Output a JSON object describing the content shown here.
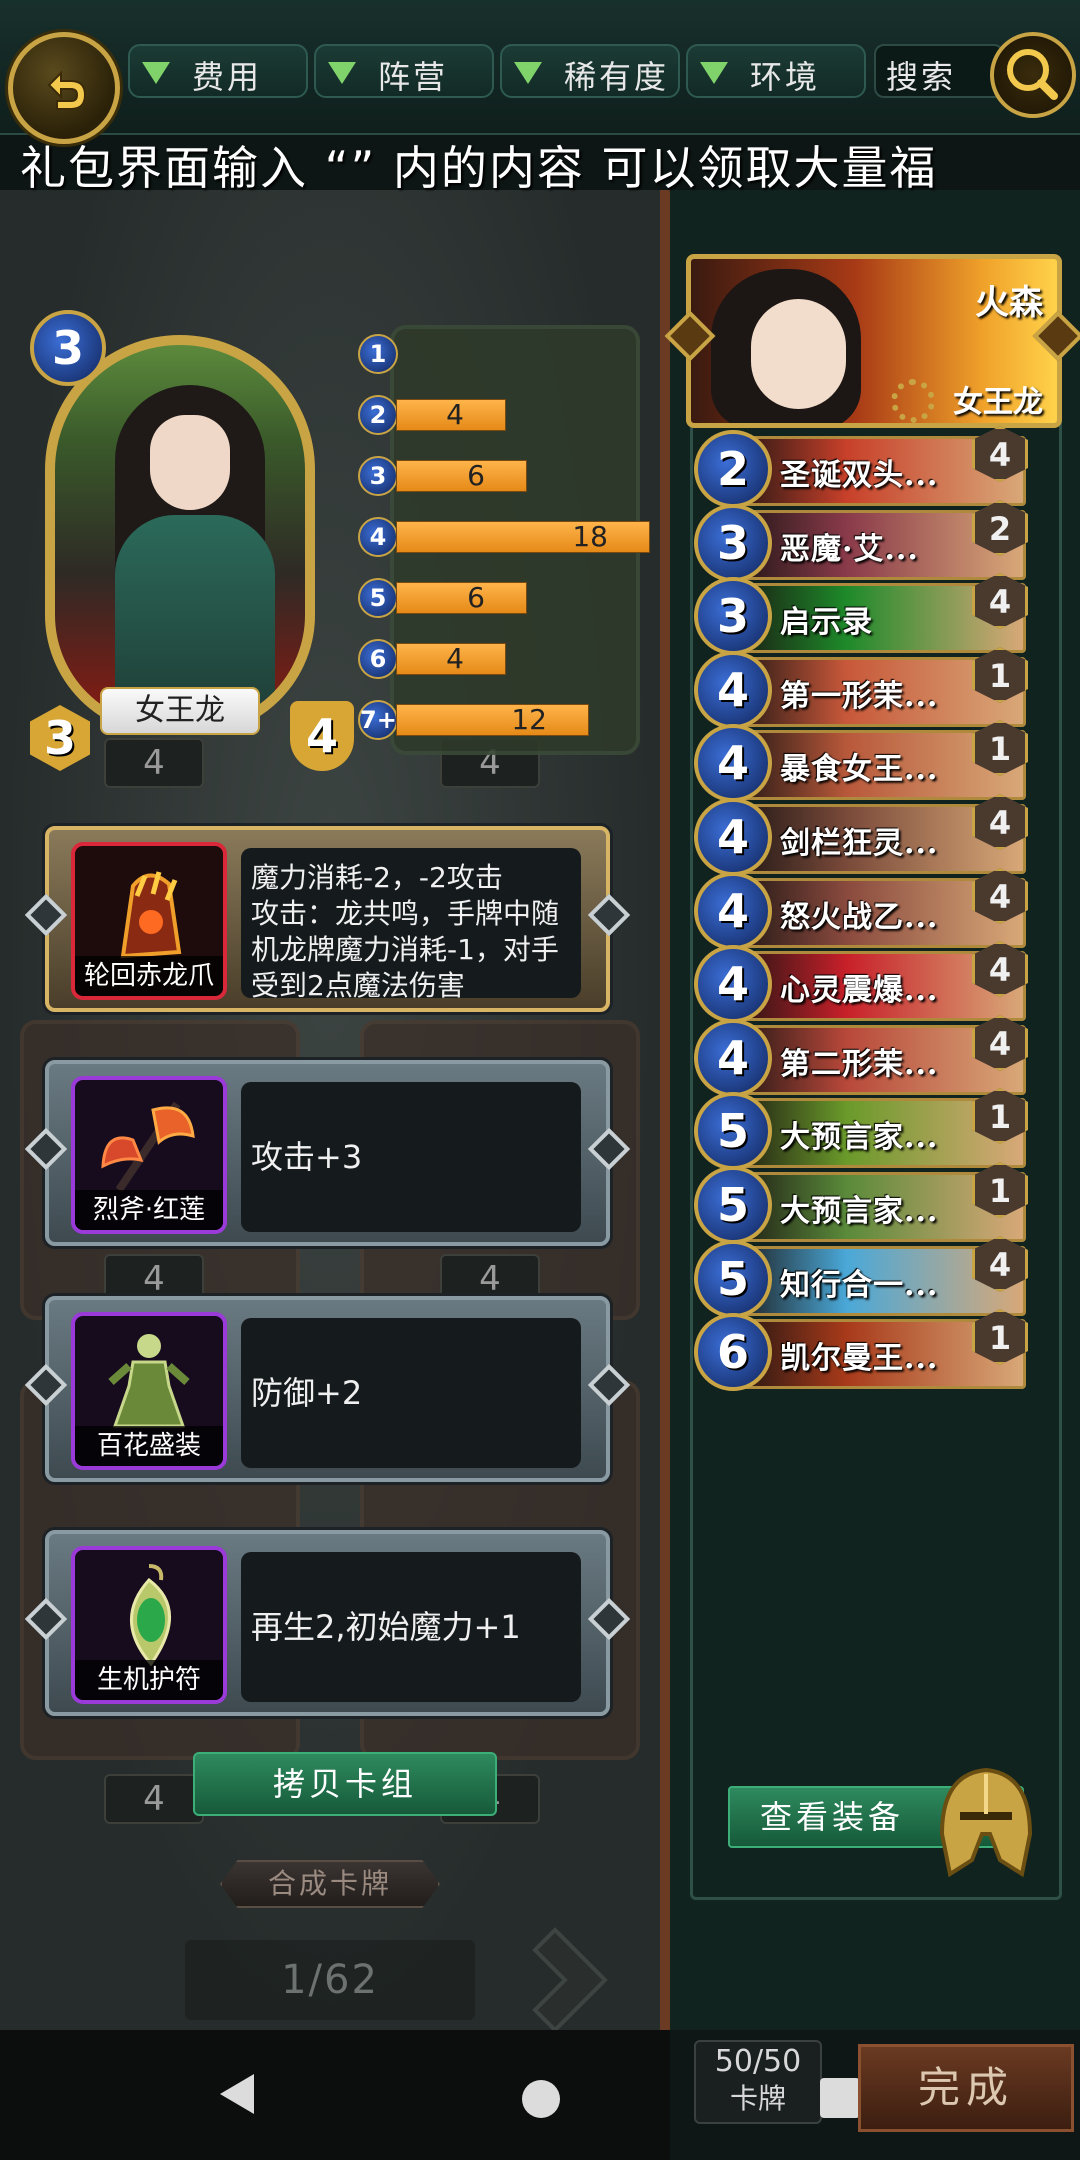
{
  "filters": [
    {
      "label": "费用"
    },
    {
      "label": "阵营"
    },
    {
      "label": "稀有度"
    },
    {
      "label": "环境"
    }
  ],
  "search": {
    "label": "搜索"
  },
  "marquee": "礼包界面输入 “” 内的内容 可以领取大量福",
  "hero_card": {
    "name": "女王龙",
    "cost": "3",
    "attack": "3",
    "defense": "4"
  },
  "mana_curve": [
    {
      "cost": "1",
      "count": "",
      "fraction": 0
    },
    {
      "cost": "2",
      "count": "4",
      "fraction": 0.22
    },
    {
      "cost": "3",
      "count": "6",
      "fraction": 0.33
    },
    {
      "cost": "4",
      "count": "18",
      "fraction": 1.0
    },
    {
      "cost": "5",
      "count": "6",
      "fraction": 0.33
    },
    {
      "cost": "6",
      "count": "4",
      "fraction": 0.22
    },
    {
      "cost": "7+",
      "count": "12",
      "fraction": 0.67
    }
  ],
  "background_counts": [
    "4",
    "4",
    "4",
    "4",
    "4",
    "4"
  ],
  "equipment": [
    {
      "name": "轮回赤龙爪",
      "description": "魔力消耗-2，-2攻击\n攻击：龙共鸣，手牌中随机龙牌魔力消耗-1，对手受到2点魔法伤害",
      "border": "#d8283a"
    },
    {
      "name": "烈斧·红莲",
      "description": "攻击+3",
      "border": "#9a3ad8"
    },
    {
      "name": "百花盛装",
      "description": "防御+2",
      "border": "#9a3ad8"
    },
    {
      "name": "生机护符",
      "description": "再生2,初始魔力+1",
      "border": "#9a3ad8"
    }
  ],
  "copy_deck_label": "拷贝卡组",
  "craft_card_label": "合成卡牌",
  "pager": "1/62",
  "deck_header": {
    "player": "火森",
    "hero": "女王龙"
  },
  "deck": [
    {
      "cost": "2",
      "name": "圣诞双头...",
      "qty": "4",
      "color": "#c8402a"
    },
    {
      "cost": "3",
      "name": "恶魔·艾...",
      "qty": "2",
      "color": "#8a3a4a"
    },
    {
      "cost": "3",
      "name": "启示录",
      "qty": "4",
      "color": "#1e8a2a"
    },
    {
      "cost": "4",
      "name": "第一形茉...",
      "qty": "1",
      "color": "#c8583a"
    },
    {
      "cost": "4",
      "name": "暴食女王...",
      "qty": "1",
      "color": "#b8583a"
    },
    {
      "cost": "4",
      "name": "剑栏狂灵...",
      "qty": "4",
      "color": "#7a4a3a"
    },
    {
      "cost": "4",
      "name": "怒火战乙...",
      "qty": "4",
      "color": "#8a4a3e"
    },
    {
      "cost": "4",
      "name": "心灵震爆...",
      "qty": "4",
      "color": "#c8202a"
    },
    {
      "cost": "4",
      "name": "第二形茉...",
      "qty": "4",
      "color": "#b8483a"
    },
    {
      "cost": "5",
      "name": "大预言家...",
      "qty": "1",
      "color": "#6a9a2a"
    },
    {
      "cost": "5",
      "name": "大预言家...",
      "qty": "1",
      "color": "#5a8a3a"
    },
    {
      "cost": "5",
      "name": "知行合一...",
      "qty": "4",
      "color": "#4aa8d8"
    },
    {
      "cost": "6",
      "name": "凯尔曼王...",
      "qty": "1",
      "color": "#a83a1a"
    }
  ],
  "view_equipment_label": "查看装备",
  "card_count": {
    "value": "50/50",
    "label": "卡牌"
  },
  "done_label": "完成"
}
